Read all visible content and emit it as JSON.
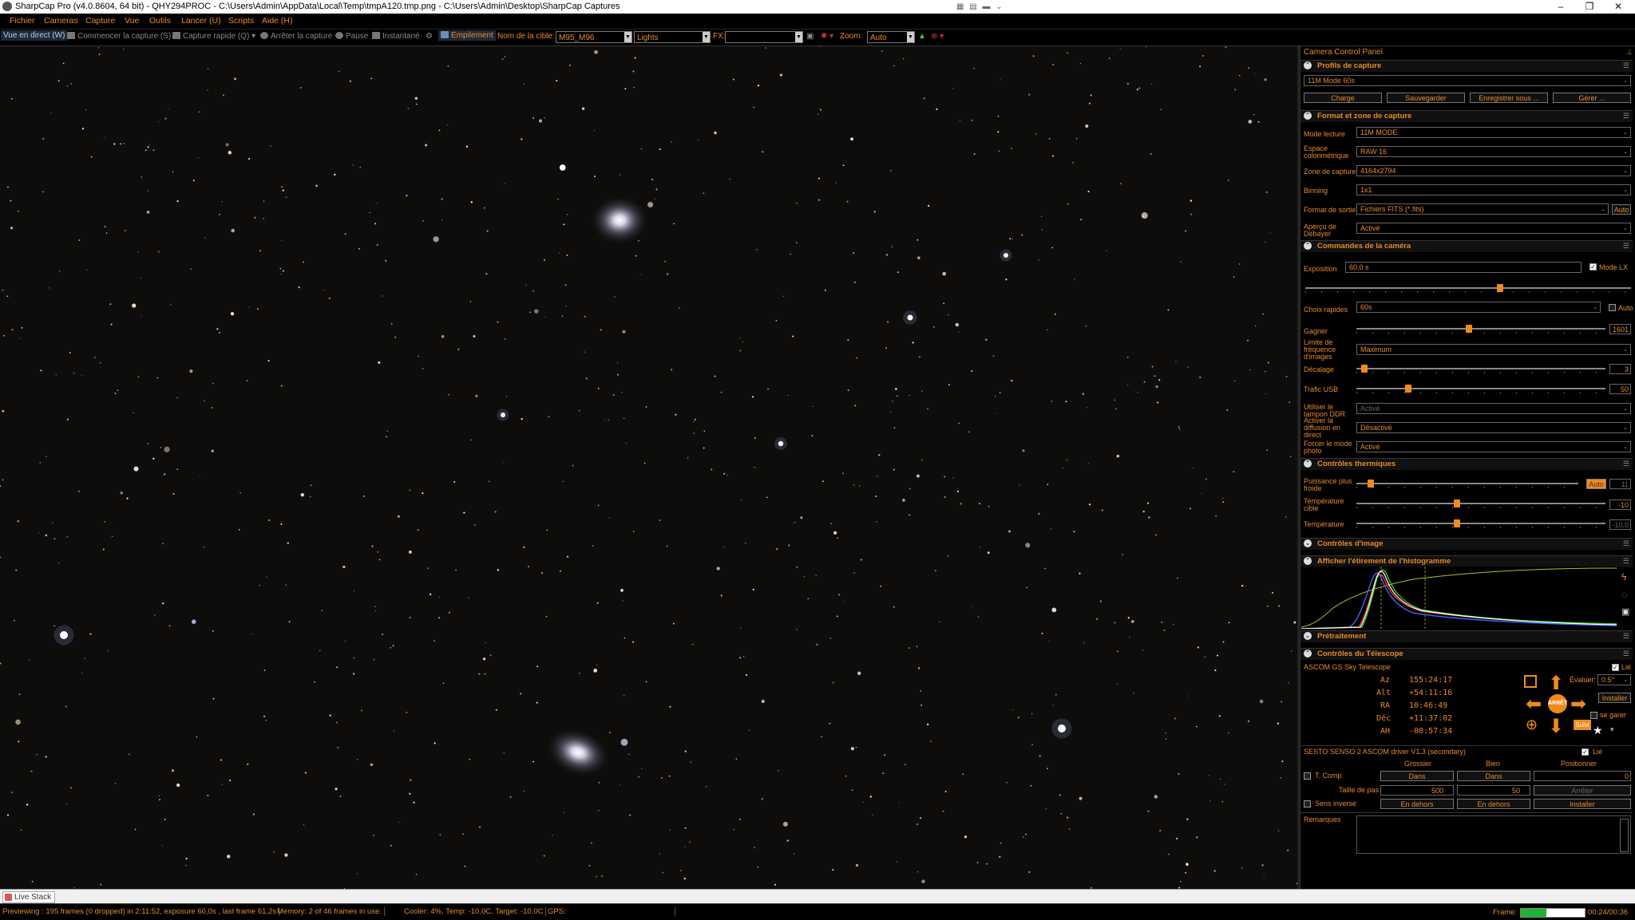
{
  "window": {
    "title": "SharpCap Pro (v4.0.8604, 64 bit) - QHY294PROC - C:\\Users\\Admin\\AppData\\Local\\Temp\\tmpA120.tmp.png - C:\\Users\\Admin\\Desktop\\SharpCap Captures"
  },
  "menu": [
    "Fichier",
    "Cameras",
    "Capture",
    "Vue",
    "Outils",
    "Lancer (U)",
    "Scripts",
    "Aide (H)"
  ],
  "toolbar": {
    "live": "Vue en direct (W)",
    "start": "Commencer la capture (S)",
    "quick": "Capture rapide (Q)",
    "stop": "Arrêter la capture",
    "pause": "Pause",
    "snapshot": "Instantané",
    "stacking": "Empilement",
    "target_label": "Nom de la cible:",
    "target_value": "M95_M96",
    "frame_type": "Lights",
    "fx_label": "FX:",
    "fx_value": "",
    "zoom_label": "Zoom:",
    "zoom_value": "Auto"
  },
  "panel": {
    "title": "Camera Control Panel",
    "profiles": {
      "header": "Profils de capture",
      "selected": "11M Mode 60s",
      "buttons": [
        "Charge",
        "Sauvegarder",
        "Enregistrer sous ...",
        "Gérer ..."
      ]
    },
    "format": {
      "header": "Format et zone de capture",
      "rows": [
        {
          "label": "Mode lecture",
          "value": "11M MODE"
        },
        {
          "label": "Espace colorimétrique",
          "value": "RAW 16"
        },
        {
          "label": "Zone de capture",
          "value": "4164x2794"
        },
        {
          "label": "Binning",
          "value": "1x1"
        },
        {
          "label": "Format de sortie",
          "value": "Fichiers FITS (*.fits)"
        },
        {
          "label": "Aperçu de Debayer",
          "value": "Activé"
        }
      ],
      "auto": "Auto"
    },
    "camera": {
      "header": "Commandes de la caméra",
      "exposure_label": "Exposition",
      "exposure_value": "60,0 s",
      "lx_mode": "Mode LX",
      "exposure_slider": 0.6,
      "quick_label": "Choix rapides",
      "quick_value": "60s",
      "quick_auto": "Auto",
      "gain_label": "Gagner",
      "gain_value": "1601",
      "gain_slider": 0.45,
      "fps_label": "Limite de fréquence d'images",
      "fps_value": "Maximum",
      "offset_label": "Décalage",
      "offset_value": "3",
      "offset_slider": 0.02,
      "usb_label": "Trafic USB",
      "usb_value": "50",
      "usb_slider": 0.2,
      "ddr_label": "Utiliser le tampon DDR",
      "ddr_value": "Activé",
      "stream_label": "Activer la diffusion en direct",
      "stream_value": "Désactivé",
      "photo_label": "Forcer le mode photo",
      "photo_value": "Activé"
    },
    "thermal": {
      "header": "Contrôles thermiques",
      "cooler_label": "Puissance plus froide",
      "cooler_auto": "Auto",
      "cooler_value": "11",
      "cooler_slider": 0.05,
      "target_label": "Température cible",
      "target_value": "-10",
      "target_slider": 0.4,
      "temp_label": "Température",
      "temp_value": "-10,0",
      "temp_slider": 0.4
    },
    "image_controls": {
      "header": "Contrôles d'image"
    },
    "histogram": {
      "header": "Afficher l'étirement de l'histogramme"
    },
    "preprocess": {
      "header": "Prétraitement"
    },
    "telescope": {
      "header": "Contrôles du Télescope",
      "name": "ASCOM GS Sky Telescope",
      "linked": "Lié",
      "coords": [
        {
          "label": "Az",
          "value": "155:24:17"
        },
        {
          "label": "Alt",
          "value": "+54:11:16"
        },
        {
          "label": "RA",
          "value": "10:46:49"
        },
        {
          "label": "Déc",
          "value": "+11:37:02"
        },
        {
          "label": "AH",
          "value": "-00:57:34"
        }
      ],
      "rate_label": "Évaluer:",
      "rate_value": "0.5°",
      "install": "Installer",
      "park": "se garer",
      "stop": "ARRÊT",
      "follow": "Suivi"
    },
    "focuser": {
      "name": "SESTO SENSO 2 ASCOM driver V1.3 (secondary)",
      "linked": "Lié",
      "col_coarse": "Grossier",
      "col_fine": "Bien",
      "col_position": "Positionner",
      "tcomp": "T. Comp",
      "in_label": "Dans",
      "position_value": "0",
      "step_label": "Taille de pas",
      "step_coarse": "500",
      "step_fine": "50",
      "stop": "Arrêter",
      "reverse": "Sens inverse",
      "out_label": "En dehors",
      "install": "Installer"
    },
    "notes_label": "Remarques"
  },
  "tabs": {
    "live_stack": "Live Stack"
  },
  "status": {
    "preview": "Previewing : 195 frames (0 dropped) in 2:11:52, exposure 60,0s , last frame 61,2s",
    "memory": "Memory: 2 of 46 frames in use.",
    "cooler": "Cooler: 4%, Temp: -10,0C, Target: -10,0C",
    "gps": "GPS:",
    "frame_label": "Frame:",
    "frame_progress": 0.4,
    "frame_time": "00:24/00:36"
  },
  "colors": {
    "accent": "#e88a2a",
    "slider": "#f08a1e",
    "progress": "#19b534"
  }
}
